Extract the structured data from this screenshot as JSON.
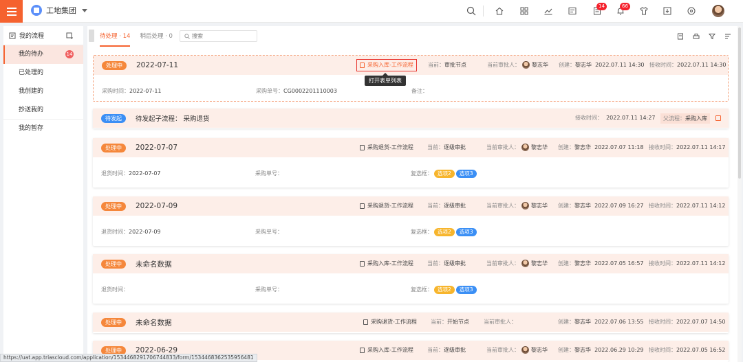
{
  "header": {
    "org_name": "工地集团",
    "notif_badge_1": "14",
    "notif_badge_2": "66"
  },
  "sidebar": {
    "title": "我的流程",
    "items": [
      {
        "label": "我的待办",
        "badge": "14"
      },
      {
        "label": "已处理的"
      },
      {
        "label": "我创建的"
      },
      {
        "label": "抄送我的"
      },
      {
        "label": "我的暂存"
      }
    ]
  },
  "tabs": [
    {
      "label": "待处理 · 14"
    },
    {
      "label": "稍后处理 · 0"
    }
  ],
  "search": {
    "placeholder": "搜索"
  },
  "tooltip": "打开表单列表",
  "cards": [
    {
      "status": "处理中",
      "title": "2022-07-11",
      "flow": "采购入库-工作流程",
      "node_label": "当前：",
      "node": "审批节点",
      "approver_label": "当前审批人：",
      "approver": "黎志华",
      "created_label": "创建：",
      "creator": "黎志华",
      "created": "2022.07.11 14:30",
      "received_label": "接收时间：",
      "received": "2022.07.11 14:30",
      "fields": [
        {
          "label": "采购时间：",
          "value": "2022-07-11"
        },
        {
          "label": "采购单号：",
          "value": "CG0002201110003"
        },
        {
          "label": "备注：",
          "value": ""
        }
      ]
    },
    {
      "status": "待发起",
      "title": "待发起子流程：  采购退货",
      "received_label": "接收时间：",
      "received": "2022.07.11 14:27",
      "parent_label": "父流程：",
      "parent": "采购入库"
    },
    {
      "status": "处理中",
      "title": "2022-07-07",
      "flow": "采购退货-工作流程",
      "node_label": "当前：",
      "node": "逐级审批",
      "approver_label": "当前审批人：",
      "approver": "黎志华",
      "created_label": "创建：",
      "creator": "黎志华",
      "created": "2022.07.07 11:18",
      "received_label": "接收时间：",
      "received": "2022.07.11 14:17",
      "fields": [
        {
          "label": "退货时间：",
          "value": "2022-07-07"
        },
        {
          "label": "采购单号：",
          "value": ""
        },
        {
          "label": "复选框：",
          "value": ""
        }
      ],
      "options": [
        "选项2",
        "选项3"
      ]
    },
    {
      "status": "处理中",
      "title": "2022-07-09",
      "flow": "采购退货-工作流程",
      "node_label": "当前：",
      "node": "逐级审批",
      "approver_label": "当前审批人：",
      "approver": "黎志华",
      "created_label": "创建：",
      "creator": "黎志华",
      "created": "2022.07.09 16:27",
      "received_label": "接收时间：",
      "received": "2022.07.11 14:12",
      "fields": [
        {
          "label": "退货时间：",
          "value": "2022-07-09"
        },
        {
          "label": "采购单号：",
          "value": ""
        },
        {
          "label": "复选框：",
          "value": ""
        }
      ],
      "options": [
        "选项2",
        "选项3"
      ]
    },
    {
      "status": "处理中",
      "title": "未命名数据",
      "flow": "采购入库-工作流程",
      "node_label": "当前：",
      "node": "逐级审批",
      "approver_label": "当前审批人：",
      "approver": "黎志华",
      "created_label": "创建：",
      "creator": "黎志华",
      "created": "2022.07.05 16:57",
      "received_label": "接收时间：",
      "received": "2022.07.11 14:12",
      "fields": [
        {
          "label": "退货时间：",
          "value": ""
        },
        {
          "label": "采购单号：",
          "value": ""
        },
        {
          "label": "复选框：",
          "value": ""
        }
      ],
      "options": [
        "选项2",
        "选项3"
      ]
    },
    {
      "status": "处理中",
      "title": "未命名数据",
      "flow": "采购退货-工作流程",
      "node_label": "当前：",
      "node": "开始节点",
      "approver_label": "当前审批人：",
      "approver": "",
      "created_label": "创建：",
      "creator": "黎志华",
      "created": "2022.07.06 13:55",
      "received_label": "接收时间：",
      "received": "2022.07.07 14:50"
    },
    {
      "status": "处理中",
      "title": "2022-06-29",
      "flow": "采购入库-工作流程",
      "node_label": "当前：",
      "node": "逐级审批",
      "approver_label": "当前审批人：",
      "approver": "黎志华",
      "created_label": "创建：",
      "creator": "黎志华",
      "created": "2022.06.29 10:29",
      "received_label": "接收时间：",
      "received": "2022.07.05 16:52"
    }
  ],
  "status_url": "https://uat.app.triascloud.com/application/1534468291706744833/form/1534468362535956481",
  "colors": {
    "accent": "#f5622f",
    "processing": "#f5873b",
    "pending": "#3b8ff5",
    "option_yellow": "#f7b52c",
    "option_blue": "#3b8ff5"
  }
}
